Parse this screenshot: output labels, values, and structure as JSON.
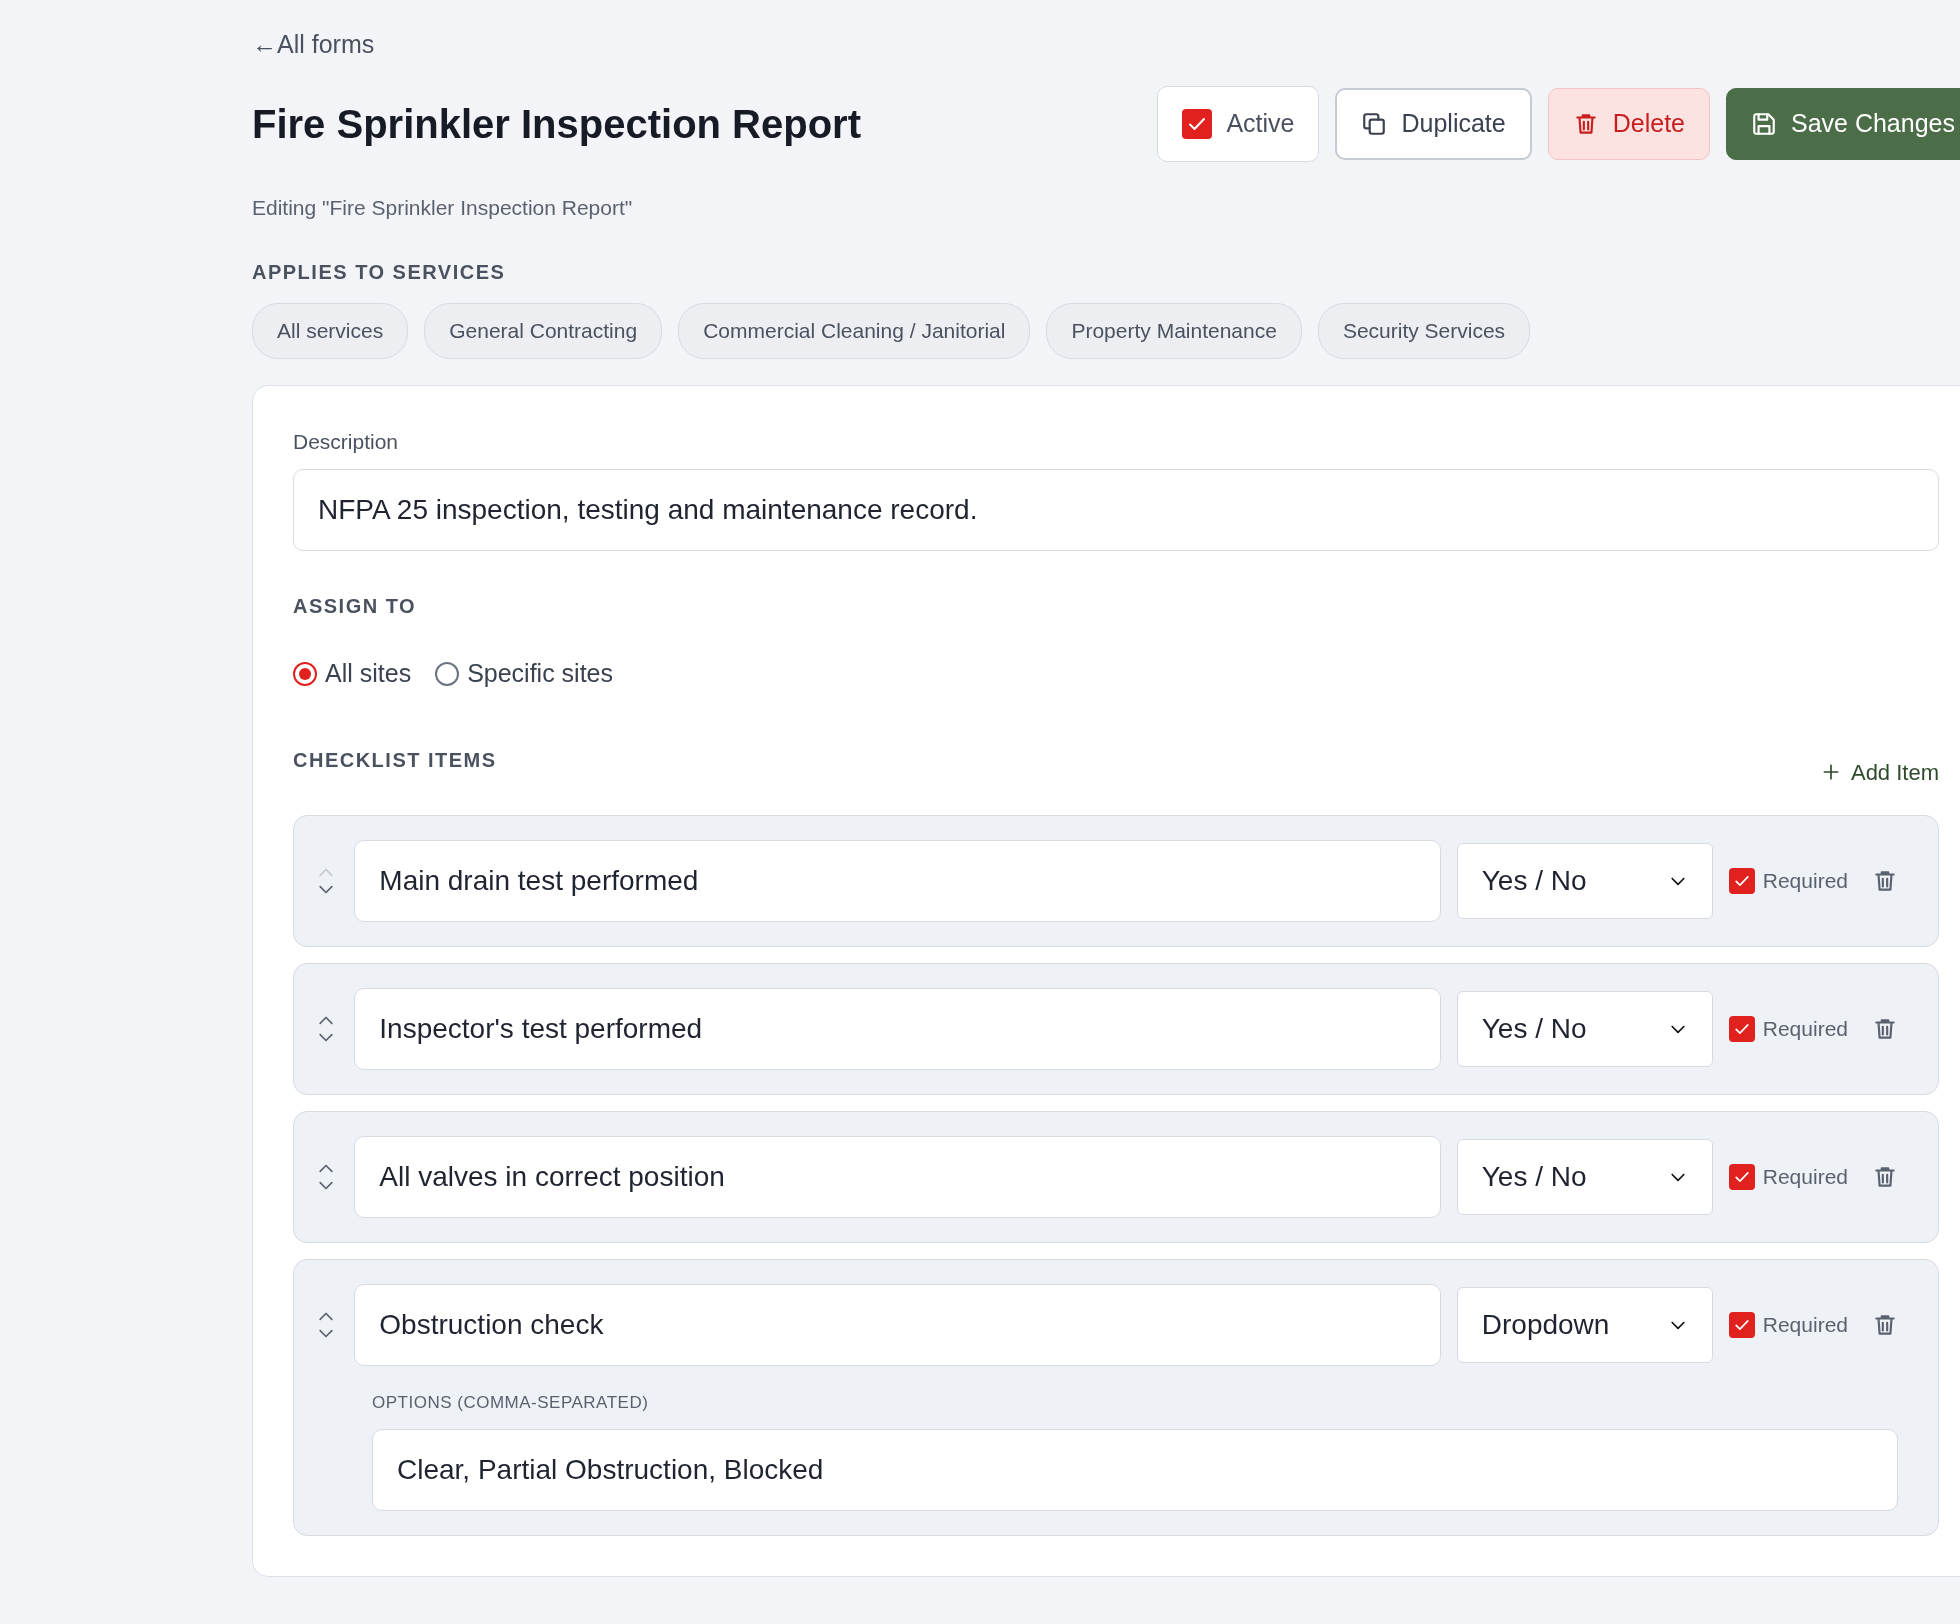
{
  "back_link": {
    "arrow": "←",
    "label": "All forms"
  },
  "title": "Fire Sprinkler Inspection Report",
  "subtitle": "Editing \"Fire Sprinkler Inspection Report\"",
  "actions": [
    {
      "kind": "toggle",
      "label": "Active",
      "checked": true
    },
    {
      "kind": "outline",
      "label": "Duplicate"
    },
    {
      "kind": "danger",
      "label": "Delete"
    },
    {
      "kind": "primary",
      "label": "Save Changes"
    }
  ],
  "services": {
    "heading": "APPLIES TO SERVICES",
    "chips": [
      "All services",
      "General Contracting",
      "Commercial Cleaning / Janitorial",
      "Property Maintenance",
      "Security Services"
    ]
  },
  "description": {
    "label": "Description",
    "value": "NFPA 25 inspection, testing and maintenance record."
  },
  "assign_to": {
    "heading": "ASSIGN TO",
    "options": [
      {
        "label": "All sites",
        "selected": true
      },
      {
        "label": "Specific sites",
        "selected": false
      }
    ]
  },
  "checklist": {
    "heading": "CHECKLIST ITEMS",
    "add_button": "Add Item",
    "items": [
      {
        "label": "Main drain test performed",
        "type": "Yes / No",
        "required": true,
        "required_label": "Required",
        "up_disabled": true
      },
      {
        "label": "Inspector's test performed",
        "type": "Yes / No",
        "required": true,
        "required_label": "Required",
        "up_disabled": false
      },
      {
        "label": "All valves in correct position",
        "type": "Yes / No",
        "required": true,
        "required_label": "Required",
        "up_disabled": false
      },
      {
        "label": "Obstruction check",
        "type": "Dropdown",
        "required": true,
        "required_label": "Required",
        "up_disabled": false,
        "options_label": "OPTIONS (COMMA-SEPARATED)",
        "options_value": "Clear, Partial Obstruction, Blocked"
      }
    ]
  }
}
